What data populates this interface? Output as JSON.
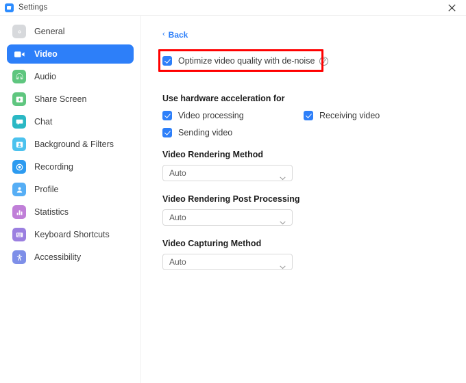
{
  "window": {
    "title": "Settings",
    "app_icon": "zoom-logo-icon",
    "close_icon": "close-icon"
  },
  "colors": {
    "accent": "#2D7FF9",
    "highlight": "#FF0000",
    "titlebar_bg": "#FFFFFF",
    "sidebar_bg": "#FFFFFF",
    "content_bg": "#FFFFFF"
  },
  "sidebar": {
    "items": [
      {
        "label": "General",
        "icon": "gear-icon",
        "color": "#D7D9DC",
        "active": false
      },
      {
        "label": "Video",
        "icon": "video-camera-icon",
        "color": "#2D7FF9",
        "active": true
      },
      {
        "label": "Audio",
        "icon": "headphones-icon",
        "color": "#5FC67F",
        "active": false
      },
      {
        "label": "Share Screen",
        "icon": "share-screen-icon",
        "color": "#5FC67F",
        "active": false
      },
      {
        "label": "Chat",
        "icon": "chat-bubble-icon",
        "color": "#2BB8C4",
        "active": false
      },
      {
        "label": "Background & Filters",
        "icon": "background-filters-icon",
        "color": "#4CC2EE",
        "active": false
      },
      {
        "label": "Recording",
        "icon": "record-icon",
        "color": "#2D9BF0",
        "active": false
      },
      {
        "label": "Profile",
        "icon": "person-icon",
        "color": "#56AEF5",
        "active": false
      },
      {
        "label": "Statistics",
        "icon": "bar-chart-icon",
        "color": "#C07FD8",
        "active": false
      },
      {
        "label": "Keyboard Shortcuts",
        "icon": "keyboard-icon",
        "color": "#9B7FE0",
        "active": false
      },
      {
        "label": "Accessibility",
        "icon": "accessibility-icon",
        "color": "#7E8FE8",
        "active": false
      }
    ]
  },
  "content": {
    "back": {
      "label": "Back",
      "chevron": "‹",
      "icon": "chevron-left-icon"
    },
    "denoise": {
      "label": "Optimize video quality with de-noise",
      "checked": true,
      "help_icon": "question-mark-icon",
      "help_glyph": "?",
      "highlighted": true
    },
    "hardware_acceleration": {
      "title": "Use hardware acceleration for",
      "options": [
        {
          "label": "Video processing",
          "checked": true
        },
        {
          "label": "Receiving video",
          "checked": true
        },
        {
          "label": "Sending video",
          "checked": true
        }
      ]
    },
    "settings_groups": [
      {
        "title": "Video Rendering Method",
        "value": "Auto",
        "arrow_icon": "chevron-down-icon"
      },
      {
        "title": "Video Rendering Post Processing",
        "value": "Auto",
        "arrow_icon": "chevron-down-icon"
      },
      {
        "title": "Video Capturing Method",
        "value": "Auto",
        "arrow_icon": "chevron-down-icon"
      }
    ]
  }
}
